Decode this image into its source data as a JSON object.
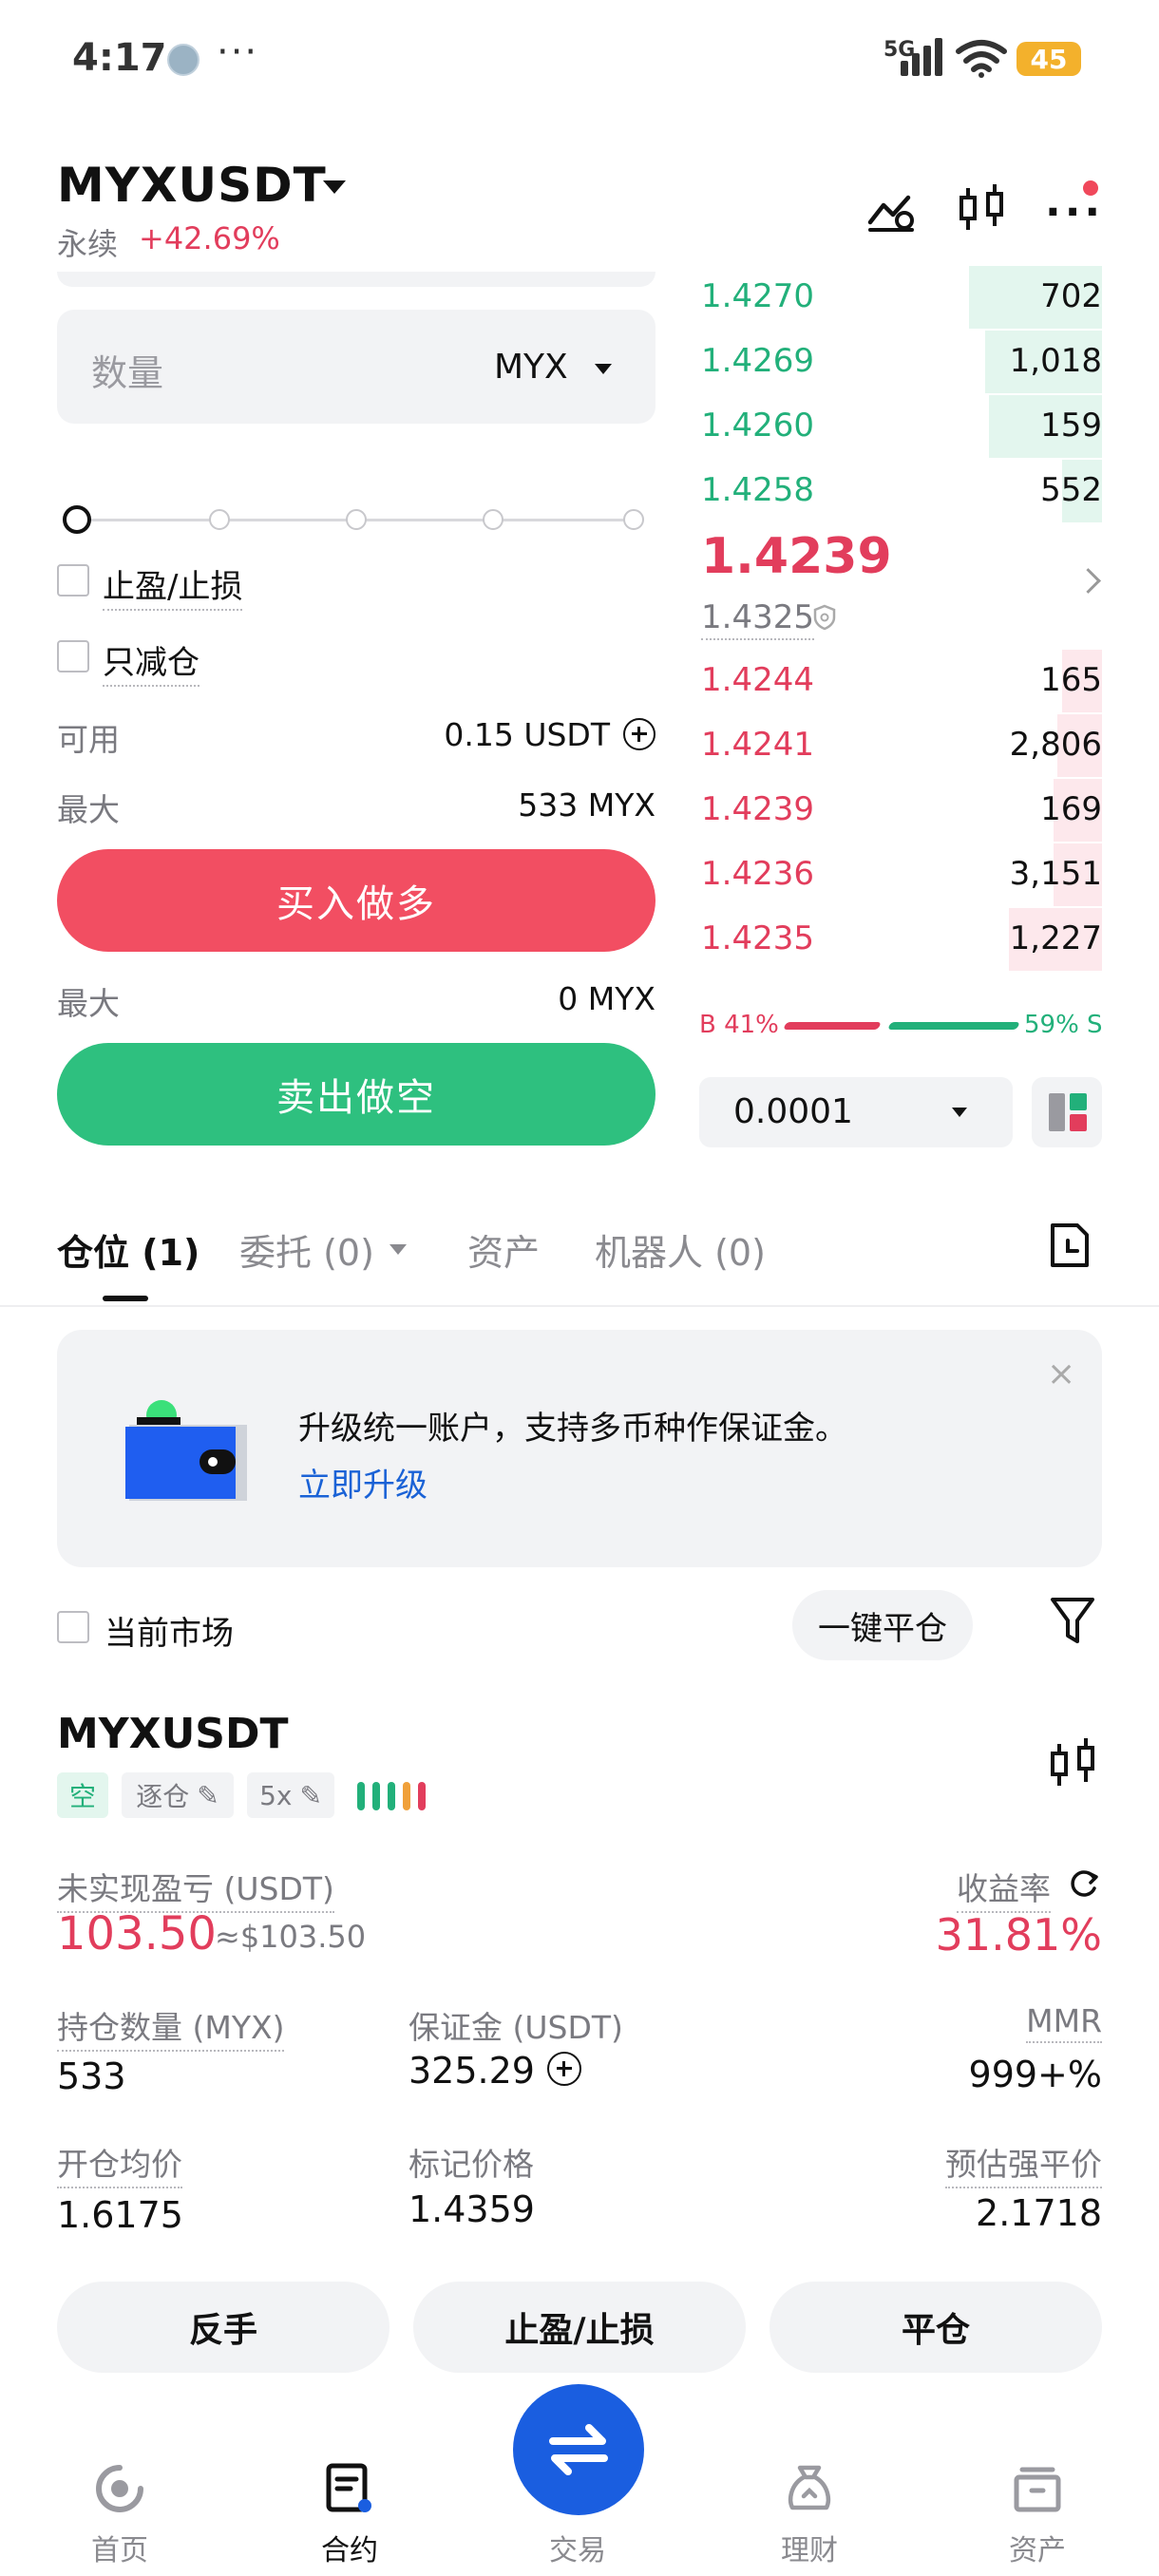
{
  "status_bar": {
    "time": "4:17",
    "dots": "···",
    "network": "5G",
    "battery": "45"
  },
  "header": {
    "pair": "MYXUSDT",
    "contract_type": "永续",
    "change": "+42.69%"
  },
  "order_form": {
    "qty_placeholder": "数量",
    "qty_unit": "MYX",
    "tp_sl_label": "止盈/止损",
    "reduce_only_label": "只减仓",
    "available_label": "可用",
    "available_value": "0.15 USDT",
    "max_buy_label": "最大",
    "max_buy_value": "533 MYX",
    "buy_label": "买入做多",
    "max_sell_label": "最大",
    "max_sell_value": "0 MYX",
    "sell_label": "卖出做空",
    "slider_percent": 0
  },
  "order_book": {
    "asks": [
      {
        "price": "1.4270",
        "qty": "702",
        "depth": 0.33
      },
      {
        "price": "1.4269",
        "qty": "1,018",
        "depth": 0.29
      },
      {
        "price": "1.4260",
        "qty": "159",
        "depth": 0.28
      },
      {
        "price": "1.4258",
        "qty": "552",
        "depth": 0.1
      }
    ],
    "last_price": "1.4239",
    "mark_price": "1.4325",
    "bids": [
      {
        "price": "1.4244",
        "qty": "165",
        "depth": 0.1
      },
      {
        "price": "1.4241",
        "qty": "2,806",
        "depth": 0.11
      },
      {
        "price": "1.4239",
        "qty": "169",
        "depth": 0.12
      },
      {
        "price": "1.4236",
        "qty": "3,151",
        "depth": 0.12
      },
      {
        "price": "1.4235",
        "qty": "1,227",
        "depth": 0.23
      }
    ],
    "buy_ratio": "B 41%",
    "sell_ratio": "59% S",
    "tick_size": "0.0001"
  },
  "tabs": {
    "positions": "仓位 (1)",
    "orders": "委托 (0)",
    "assets": "资产",
    "bots": "机器人 (0)"
  },
  "banner": {
    "text": "升级统一账户，支持多币种作保证金。",
    "link": "立即升级",
    "close": "×"
  },
  "filter": {
    "current_market": "当前市场",
    "close_all": "一键平仓"
  },
  "position": {
    "symbol": "MYXUSDT",
    "side_tag": "空",
    "margin_mode_tag": "逐仓",
    "leverage_tag": "5x",
    "unrealized_pnl_label": "未实现盈亏 (USDT)",
    "unrealized_pnl": "103.50",
    "unrealized_pnl_approx": "≈$103.50",
    "roe_label": "收益率",
    "roe": "31.81%",
    "size_label": "持仓数量 (MYX)",
    "size": "533",
    "margin_label": "保证金 (USDT)",
    "margin": "325.29",
    "mmr_label": "MMR",
    "mmr": "999+%",
    "entry_label": "开仓均价",
    "entry": "1.6175",
    "mark_label": "标记价格",
    "mark": "1.4359",
    "liq_label": "预估强平价",
    "liq": "2.1718",
    "reverse_btn": "反手",
    "tpsl_btn": "止盈/止损",
    "close_btn": "平仓"
  },
  "bottom_nav": {
    "home": "首页",
    "futures": "合约",
    "trade": "交易",
    "earn": "理财",
    "assets": "资产"
  },
  "colors": {
    "buy": "#22b07a",
    "sell": "#e23d5c",
    "accent": "#1a5ee0",
    "liq": "#e7903a"
  }
}
